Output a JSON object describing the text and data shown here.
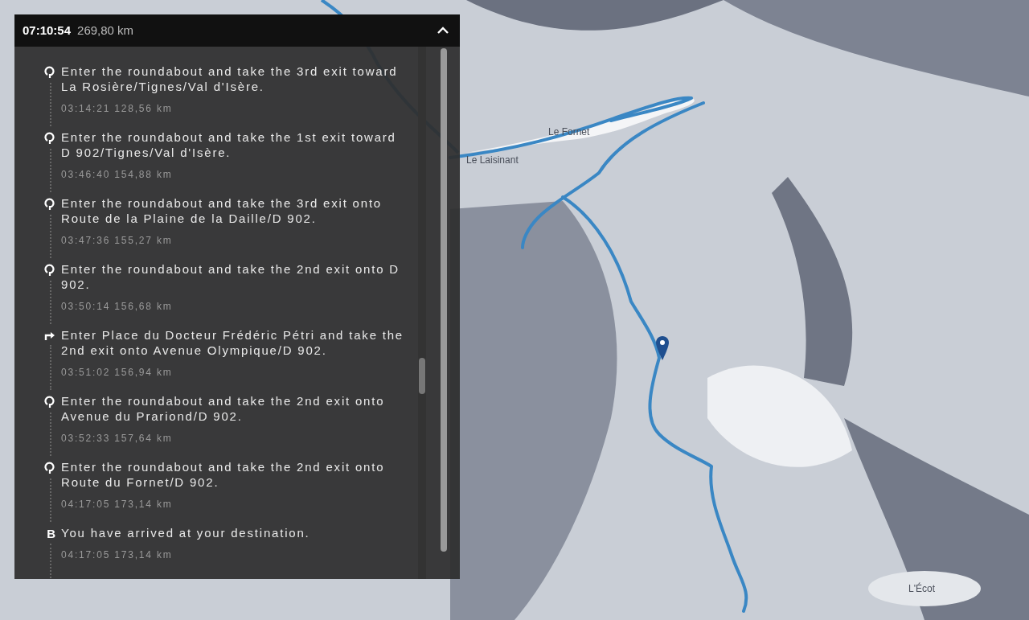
{
  "summary": {
    "duration": "07:10:54",
    "distance": "269,80 km",
    "expanded": true
  },
  "steps": [
    {
      "kind": "roundabout",
      "instruction": "Enter the roundabout and take the 3rd exit toward La Rosière/Tignes/Val d'Isère.",
      "meta": "03:14:21 128,56 km"
    },
    {
      "kind": "roundabout",
      "instruction": "Enter the roundabout and take the 1st exit toward D 902/Tignes/Val d'Isère.",
      "meta": "03:46:40 154,88 km"
    },
    {
      "kind": "roundabout",
      "instruction": "Enter the roundabout and take the 3rd exit onto Route de la Plaine de la Daille/D 902.",
      "meta": "03:47:36 155,27 km"
    },
    {
      "kind": "roundabout",
      "instruction": "Enter the roundabout and take the 2nd exit onto D 902.",
      "meta": "03:50:14 156,68 km"
    },
    {
      "kind": "turn-right",
      "instruction": "Enter Place du Docteur Frédéric Pétri and take the 2nd exit onto Avenue Olympique/D 902.",
      "meta": "03:51:02 156,94 km"
    },
    {
      "kind": "roundabout",
      "instruction": "Enter the roundabout and take the 2nd exit onto Avenue du Prariond/D 902.",
      "meta": "03:52:33 157,64 km"
    },
    {
      "kind": "roundabout",
      "instruction": "Enter the roundabout and take the 2nd exit onto Route du Fornet/D 902.",
      "meta": "04:17:05 173,14 km"
    },
    {
      "kind": "destination",
      "marker": "B",
      "instruction": "You have arrived at your destination.",
      "meta": "04:17:05 173,14 km"
    }
  ],
  "map_labels": [
    "Le Fornet",
    "Le Laisinant",
    "L'Écot"
  ]
}
